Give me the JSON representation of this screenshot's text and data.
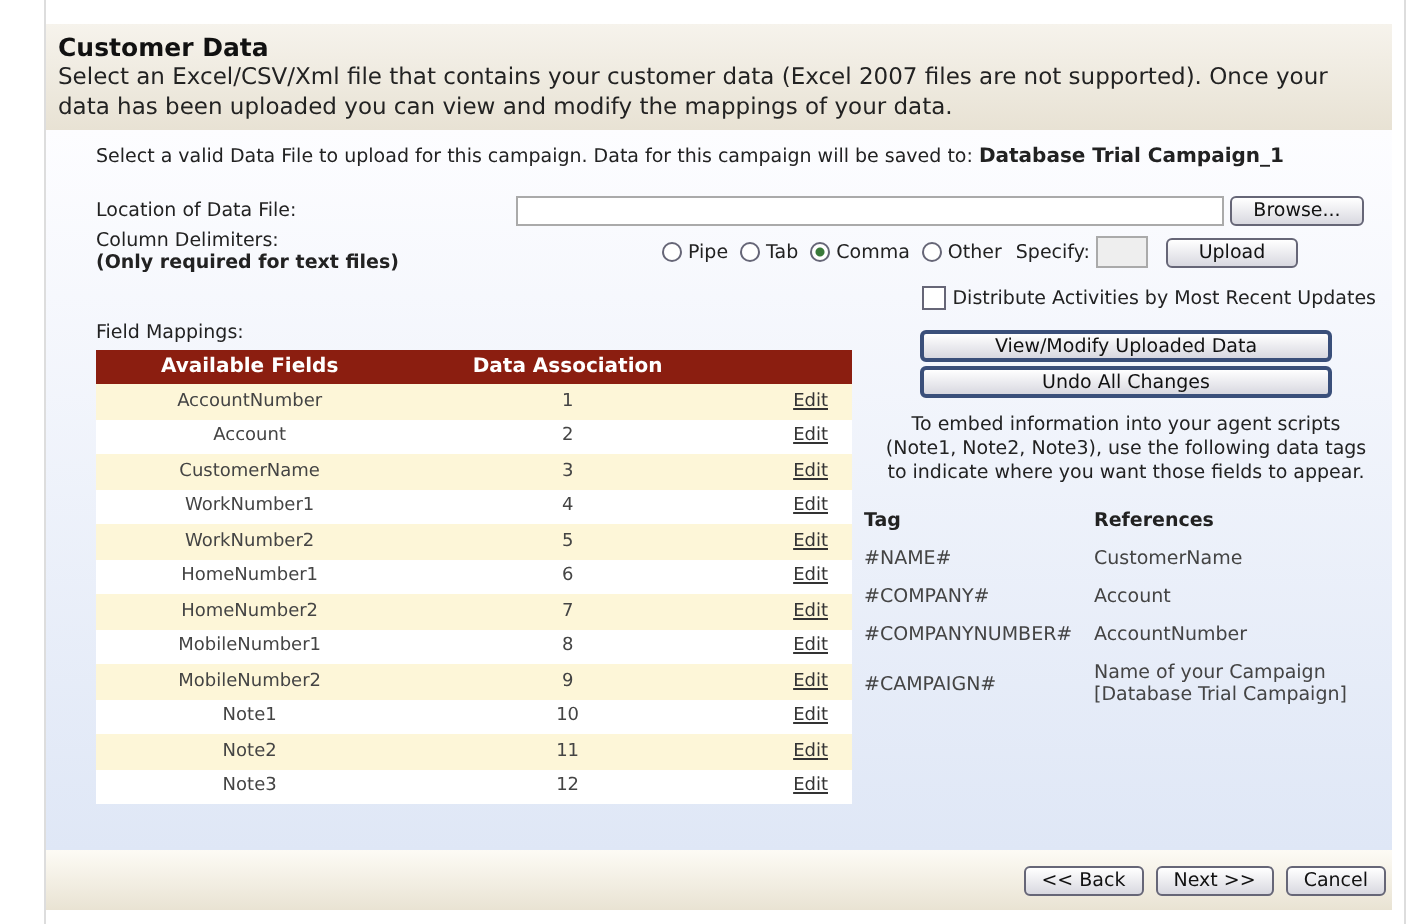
{
  "header": {
    "title": "Customer Data",
    "description": "Select an Excel/CSV/Xml file that contains your customer data (Excel 2007 files are not supported). Once your data has been uploaded you can view and modify the mappings of your data."
  },
  "intro": "Select a valid Data File to upload for this campaign. Data for this campaign will be saved to: **Database Trial Campaign_1**",
  "file": {
    "label": "Location of Data File:",
    "browse": "Browse..."
  },
  "delimiters": {
    "label": "Column Delimiters:",
    "note": "(Only required for text files)",
    "options": [
      {
        "label": "Pipe",
        "selected": false
      },
      {
        "label": "Tab",
        "selected": false
      },
      {
        "label": "Comma",
        "selected": true
      },
      {
        "label": "Other",
        "selected": false
      }
    ],
    "specify": "Specify:",
    "upload": "Upload"
  },
  "distribute": {
    "label": "Distribute Activities by Most Recent Updates",
    "checked": false
  },
  "mappings": {
    "label": "Field Mappings:",
    "columns": [
      "Available Fields",
      "Data Association"
    ],
    "rows": [
      {
        "field": "AccountNumber",
        "association": "1",
        "action": "Edit"
      },
      {
        "field": "Account",
        "association": "2",
        "action": "Edit"
      },
      {
        "field": "CustomerName",
        "association": "3",
        "action": "Edit"
      },
      {
        "field": "WorkNumber1",
        "association": "4",
        "action": "Edit"
      },
      {
        "field": "WorkNumber2",
        "association": "5",
        "action": "Edit"
      },
      {
        "field": "HomeNumber1",
        "association": "6",
        "action": "Edit"
      },
      {
        "field": "HomeNumber2",
        "association": "7",
        "action": "Edit"
      },
      {
        "field": "MobileNumber1",
        "association": "8",
        "action": "Edit"
      },
      {
        "field": "MobileNumber2",
        "association": "9",
        "action": "Edit"
      },
      {
        "field": "Note1",
        "association": "10",
        "action": "Edit"
      },
      {
        "field": "Note2",
        "association": "11",
        "action": "Edit"
      },
      {
        "field": "Note3",
        "association": "12",
        "action": "Edit"
      }
    ]
  },
  "actions": [
    "View/Modify Uploaded Data",
    "Undo All Changes"
  ],
  "embed_note": "To embed information into your agent scripts (Note1, Note2, Note3), use the following data tags to indicate where you want those fields to appear.",
  "tags": {
    "columns": [
      "Tag",
      "References"
    ],
    "rows": [
      {
        "tag": "#NAME#",
        "reference": "CustomerName"
      },
      {
        "tag": "#COMPANY#",
        "reference": "Account"
      },
      {
        "tag": "#COMPANYNUMBER#",
        "reference": "AccountNumber"
      },
      {
        "tag": "#CAMPAIGN#",
        "reference": "Name of your Campaign [Database Trial Campaign]"
      }
    ]
  },
  "footer": [
    "<< Back",
    "Next >>",
    "Cancel"
  ]
}
